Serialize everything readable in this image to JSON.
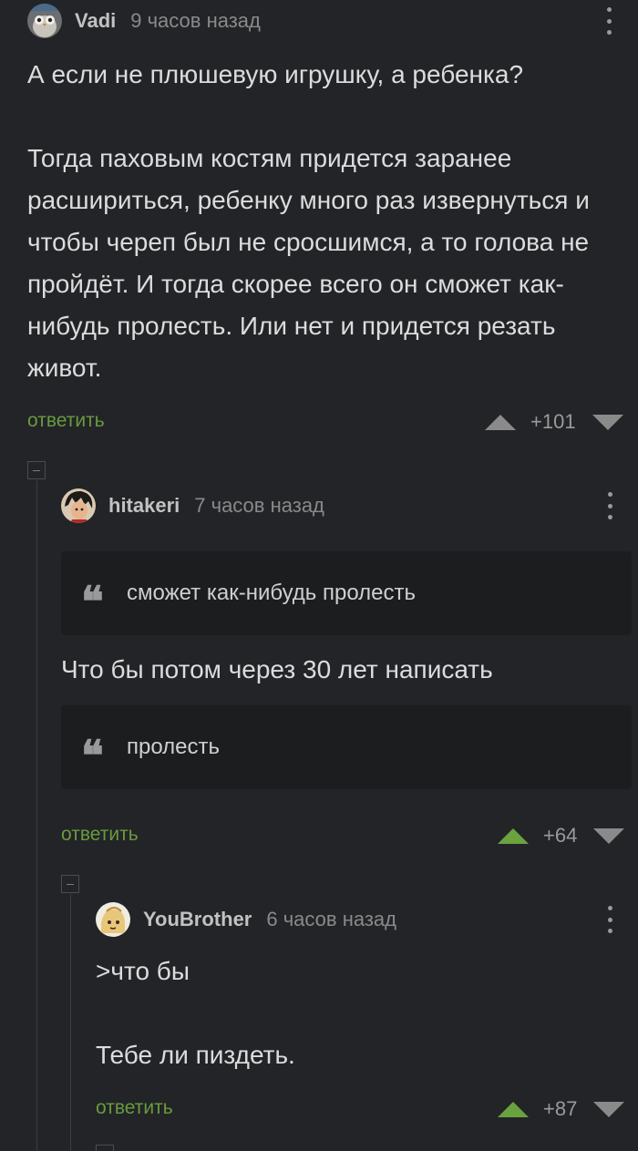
{
  "comments": [
    {
      "username": "Vadi",
      "time": "9 часов назад",
      "avatar": "owl-avatar",
      "text": "А если не плюшевую игрушку, а ребенка?\n\nТогда паховым костям придется заранее расшириться, ребенку много раз извернуться и чтобы череп был не сросшимся, а то голова не пройдёт. И тогда скорее всего он сможет как-нибудь пролесть. Или нет и придется резать живот.",
      "reply_label": "ответить",
      "rating": "+101",
      "upvoted": false
    },
    {
      "username": "hitakeri",
      "time": "7 часов назад",
      "avatar": "anime-character-avatar",
      "quote1": "сможет как-нибудь пролесть",
      "text": "Что бы потом через 30 лет написать",
      "quote2": "пролесть",
      "reply_label": "ответить",
      "rating": "+64",
      "upvoted": true
    },
    {
      "username": "YouBrother",
      "time": "6 часов назад",
      "avatar": "cartoon-avatar",
      "text": ">что бы\n\nТебе ли пиздеть.",
      "reply_label": "ответить",
      "rating": "+87",
      "upvoted": true
    }
  ],
  "icons": {
    "quote": "quote-icon",
    "more": "more-vertical-icon",
    "upvote": "upvote-icon",
    "downvote": "downvote-icon",
    "collapse": "collapse-icon"
  },
  "colors": {
    "background": "#222427",
    "quote_background": "#1c1d1f",
    "reply_link": "#6a9a3e",
    "upvote_active": "#6aa240",
    "text": "#dcdcdc",
    "muted": "#8a8a8a"
  }
}
